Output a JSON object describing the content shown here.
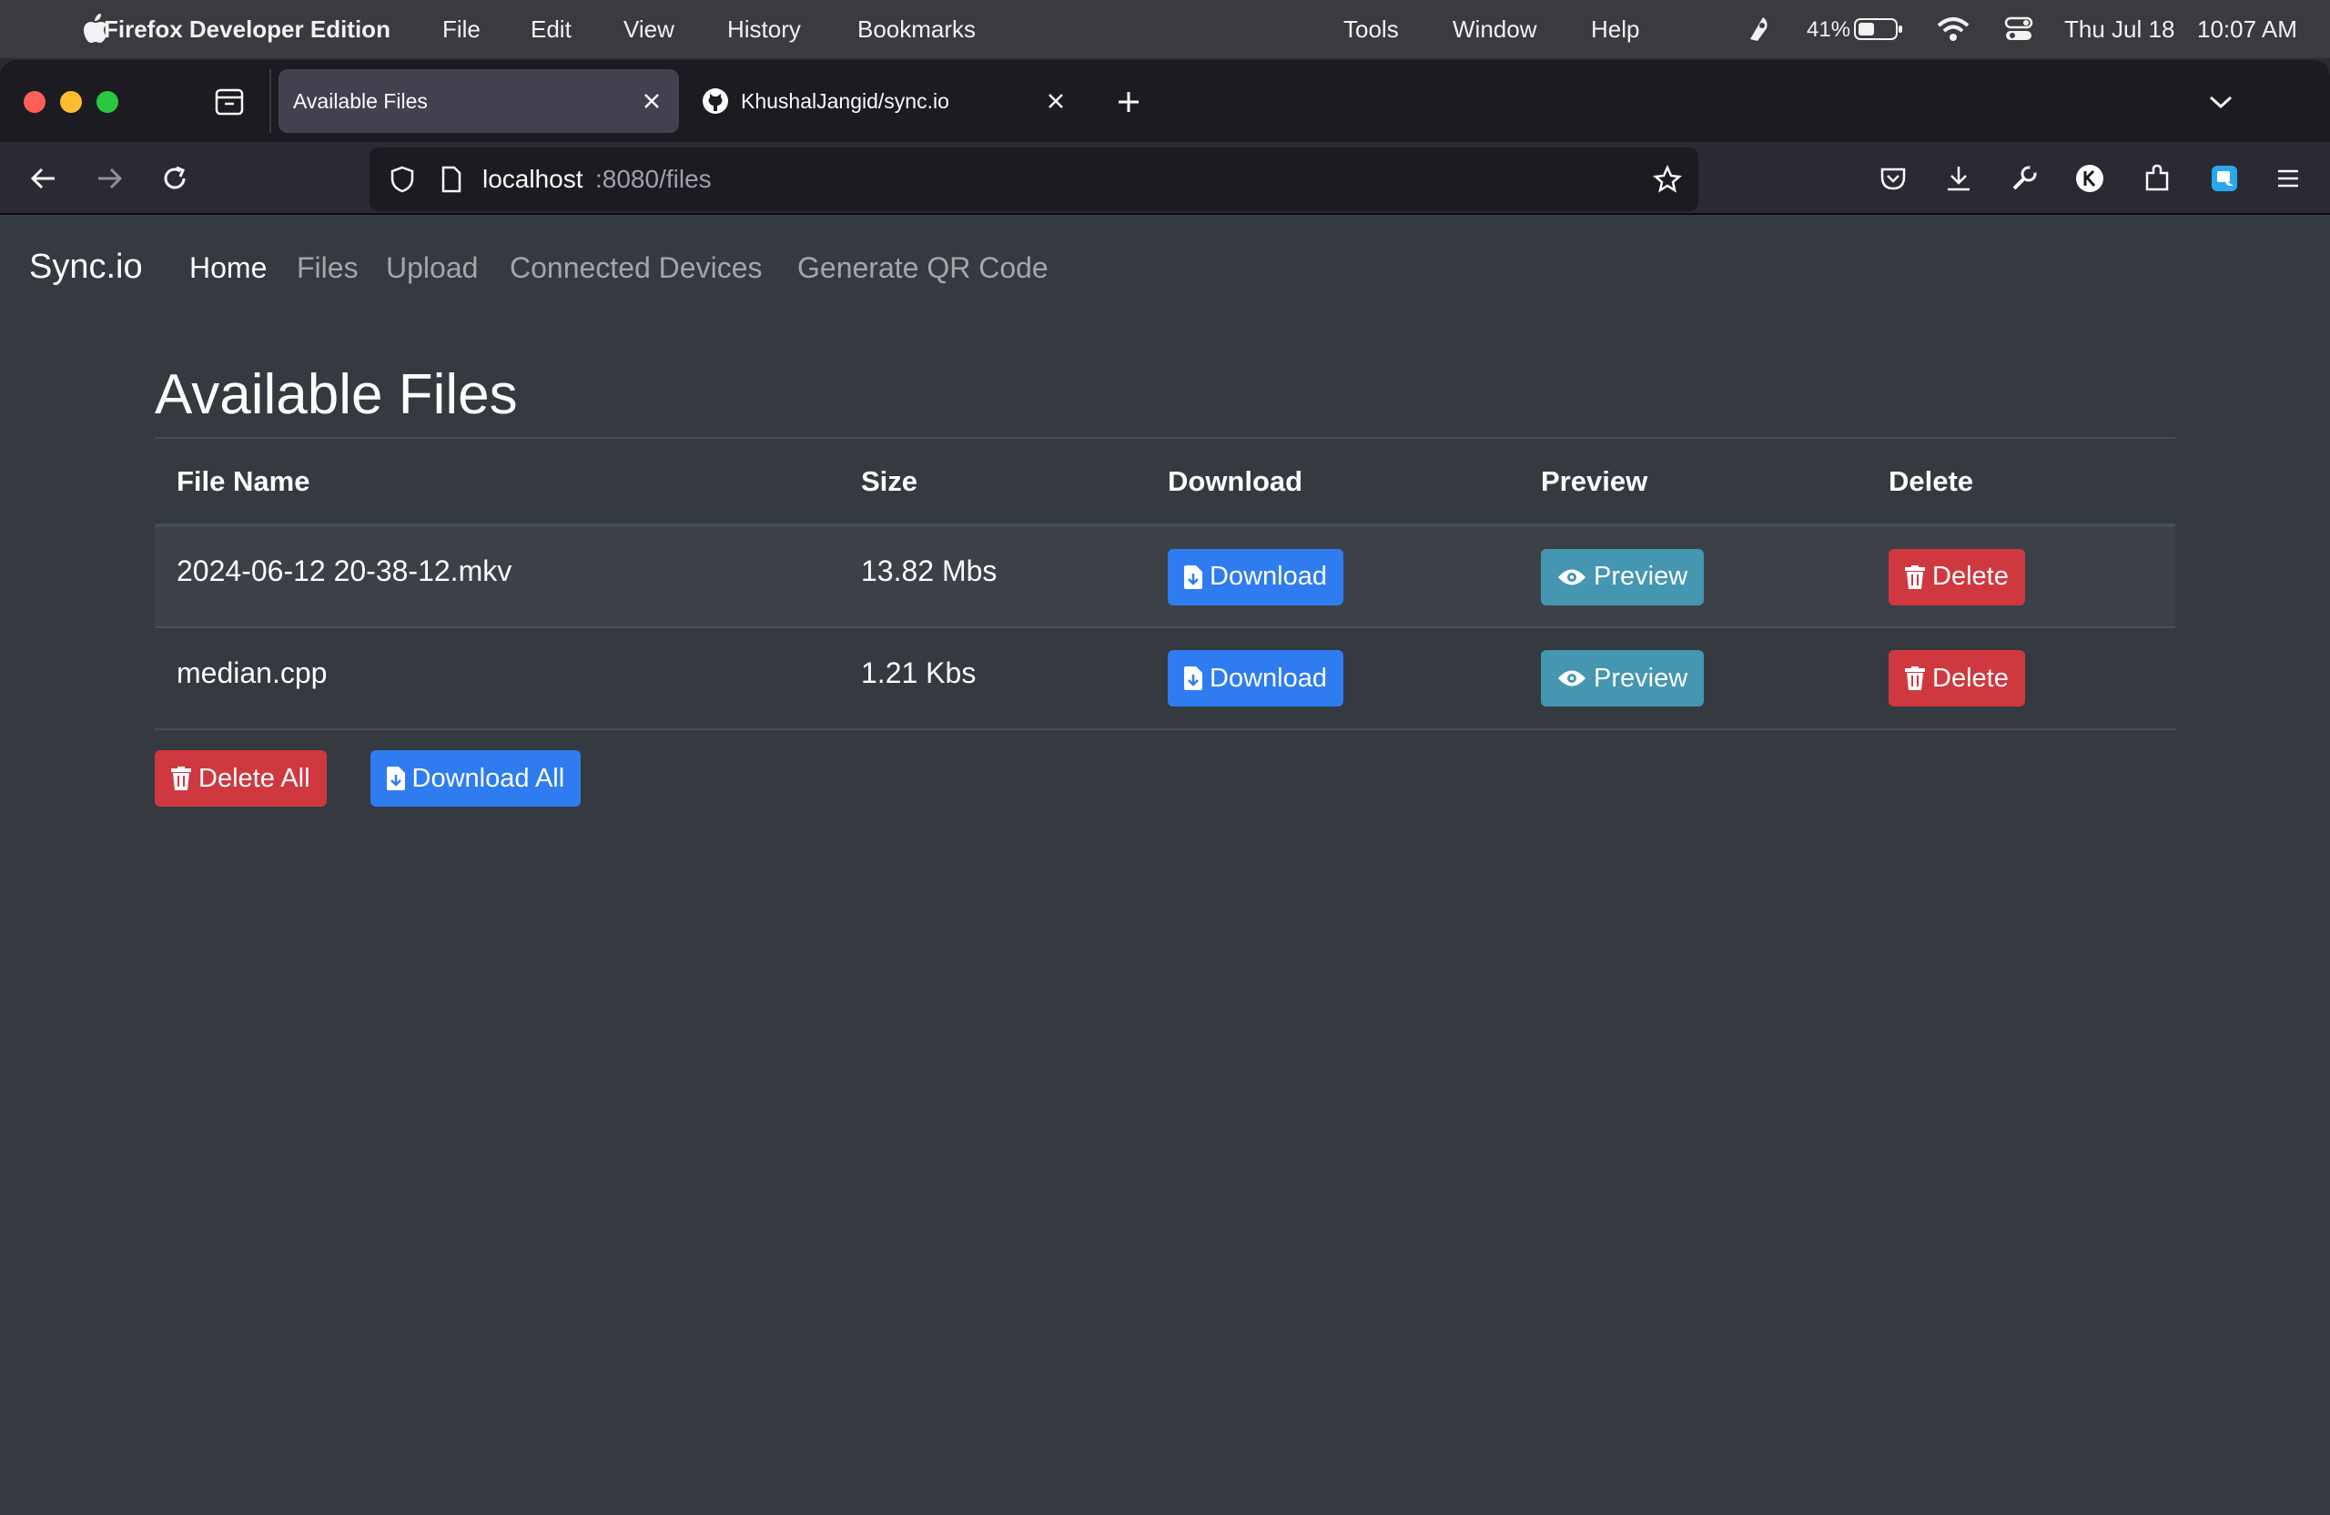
{
  "menubar": {
    "app_name": "Firefox Developer Edition",
    "items": [
      "File",
      "Edit",
      "View",
      "History",
      "Bookmarks",
      "Tools",
      "Window",
      "Help"
    ],
    "battery_percent": "41%",
    "date": "Thu Jul 18",
    "time": "10:07 AM"
  },
  "tabs": [
    {
      "title": "Available Files",
      "active": true
    },
    {
      "title": "KhushalJangid/sync.io",
      "active": false
    }
  ],
  "url": {
    "host": "localhost",
    "rest": ":8080/files"
  },
  "navbar": {
    "brand": "Sync.io",
    "links": [
      "Home",
      "Files",
      "Upload",
      "Connected Devices",
      "Generate QR Code"
    ],
    "active_index": 0
  },
  "main": {
    "title": "Available Files",
    "columns": [
      "File Name",
      "Size",
      "Download",
      "Preview",
      "Delete"
    ],
    "rows": [
      {
        "name": "2024-06-12 20-38-12.mkv",
        "size": "13.82 Mbs"
      },
      {
        "name": "median.cpp",
        "size": "1.21 Kbs"
      }
    ],
    "download_label": "Download",
    "preview_label": "Preview",
    "delete_label": "Delete",
    "delete_all_label": "Delete All",
    "download_all_label": "Download All"
  },
  "colors": {
    "primary": "#2f7cf0",
    "info": "#4496b1",
    "danger": "#d0383f",
    "page_bg": "#343a40"
  }
}
